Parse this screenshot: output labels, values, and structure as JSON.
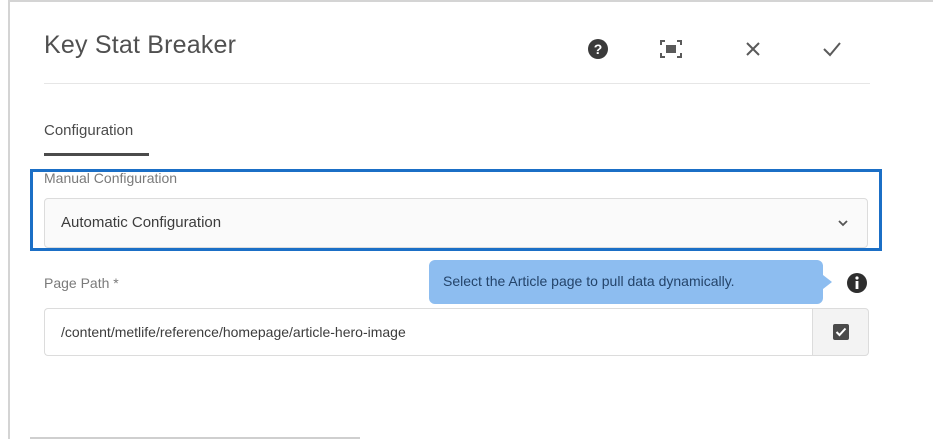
{
  "dialog": {
    "title": "Key Stat Breaker",
    "actions": [
      {
        "name": "help",
        "icon": "help-icon"
      },
      {
        "name": "fullscreen",
        "icon": "fullscreen-icon"
      },
      {
        "name": "close",
        "icon": "close-icon"
      },
      {
        "name": "done",
        "icon": "checkmark-icon"
      }
    ]
  },
  "tabs": [
    {
      "label": "Configuration",
      "active": true
    }
  ],
  "form": {
    "configuration": {
      "label": "Manual Configuration",
      "selected": "Automatic Configuration",
      "icon": "chevron-down-icon"
    },
    "page_path": {
      "label": "Page Path *",
      "value": "/content/metlife/reference/homepage/article-hero-image",
      "tooltip": "Select the Article page to pull data dynamically.",
      "info_icon": "info-icon",
      "picker_icon": "checkbox-icon"
    }
  },
  "colors": {
    "highlight": "#1b6fc6",
    "tooltip_bg": "#8dbdf0"
  }
}
